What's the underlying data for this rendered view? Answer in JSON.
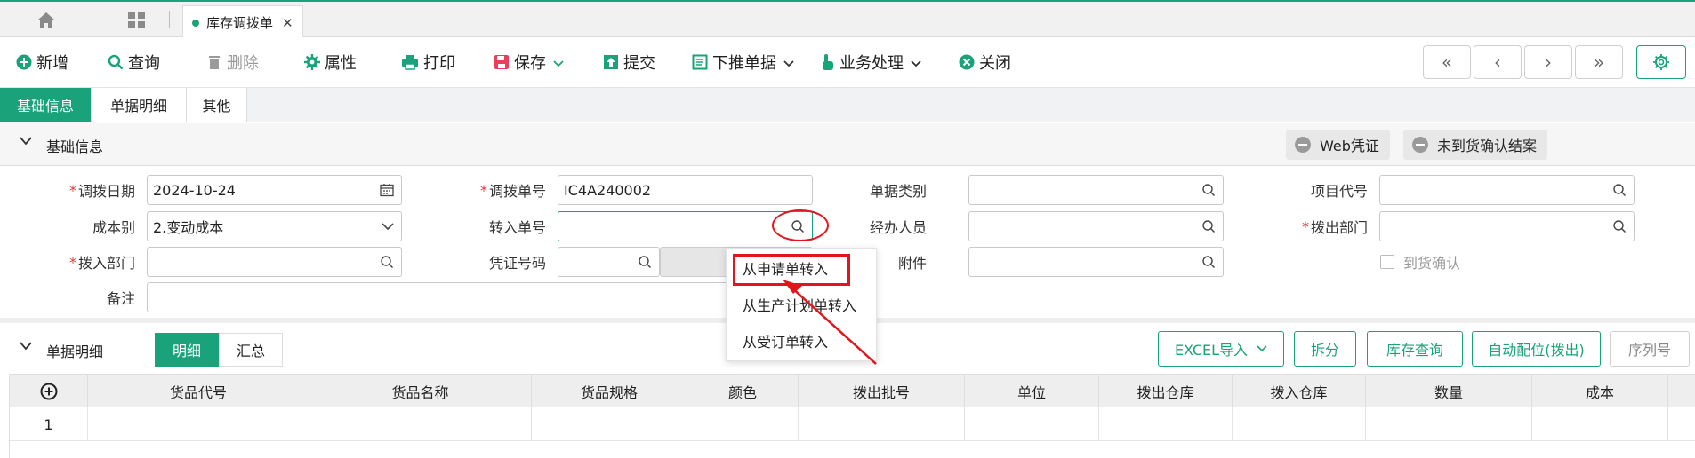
{
  "tabs": {
    "current": "库存调拨单"
  },
  "toolbar": {
    "new": "新增",
    "query": "查询",
    "delete": "删除",
    "property": "属性",
    "print": "打印",
    "save": "保存",
    "submit": "提交",
    "push_down": "下推单据",
    "business": "业务处理",
    "close": "关闭"
  },
  "section_tabs": [
    "基础信息",
    "单据明细",
    "其他"
  ],
  "basic": {
    "title": "基础信息",
    "web_voucher": "Web凭证",
    "confirm_settle": "未到货确认结案",
    "fields": {
      "transfer_date_label": "调拨日期",
      "transfer_date": "2024-10-24",
      "transfer_no_label": "调拨单号",
      "transfer_no": "IC4A240002",
      "doc_type_label": "单据类别",
      "project_code_label": "项目代号",
      "cost_type_label": "成本别",
      "cost_type": "2.变动成本",
      "import_no_label": "转入单号",
      "handler_label": "经办人员",
      "out_dept_label": "拨出部门",
      "in_dept_label": "拨入部门",
      "voucher_no_label": "凭证号码",
      "attachment_label": "附件",
      "arrival_confirm_label": "到货确认",
      "remark_label": "备注"
    }
  },
  "popup": [
    "从申请单转入",
    "从生产计划单转入",
    "从受订单转入"
  ],
  "detail": {
    "title": "单据明细",
    "seg": [
      "明细",
      "汇总"
    ],
    "buttons": {
      "excel": "EXCEL导入",
      "split": "拆分",
      "stock_query": "库存查询",
      "auto_alloc": "自动配位(拨出)",
      "serial": "序列号"
    },
    "columns": [
      "货品代号",
      "货品名称",
      "货品规格",
      "颜色",
      "拨出批号",
      "单位",
      "拨出仓库",
      "拨入仓库",
      "数量",
      "成本"
    ],
    "rows": [
      {
        "index": "1"
      }
    ]
  }
}
